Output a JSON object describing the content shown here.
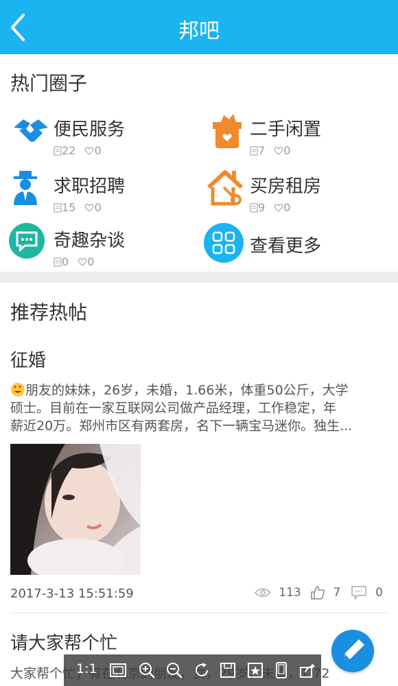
{
  "header": {
    "title": "邦吧"
  },
  "circles_section": {
    "title": "热门圈子",
    "items": [
      {
        "name": "便民服务",
        "posts": "22",
        "likes": "0",
        "icon": "handshake-icon",
        "color": "#1a8ee0"
      },
      {
        "name": "二手闲置",
        "posts": "7",
        "likes": "0",
        "icon": "gift-box-icon",
        "color": "#f08a2c"
      },
      {
        "name": "求职招聘",
        "posts": "15",
        "likes": "0",
        "icon": "businessman-icon",
        "color": "#1a8ee0"
      },
      {
        "name": "买房租房",
        "posts": "9",
        "likes": "0",
        "icon": "house-key-icon",
        "color": "#f08a2c"
      },
      {
        "name": "奇趣杂谈",
        "posts": "0",
        "likes": "0",
        "icon": "chat-bubble-icon",
        "color": "#1fb6a0"
      },
      {
        "name": "查看更多",
        "icon": "grid-icon",
        "color": "#1ab4f0"
      }
    ]
  },
  "hot_posts": {
    "title": "推荐热帖",
    "posts": [
      {
        "title": "征婚",
        "line1": "朋友的妹妹，26岁，未婚，1.66米，体重50公斤，大学",
        "line2": "硕士。目前在一家互联网公司做产品经理，工作稳定，年",
        "line3": "薪近20万。郑州市区有两套房，名下一辆宝马迷你。独生...",
        "time": "2017-3-13 15:51:59",
        "views": "113",
        "likes": "7",
        "comments": "0"
      },
      {
        "title": "请大家帮个忙",
        "excerpt": "大家帮个忙，有在北京的朋友，女，29岁，未婚，1.72"
      }
    ]
  },
  "viewer_bar": {
    "ratio_label": "1:1"
  },
  "colors": {
    "accent": "#1ab4f0",
    "fab": "#1a8ee0",
    "orange": "#f08a2c",
    "teal": "#1fb6a0"
  }
}
